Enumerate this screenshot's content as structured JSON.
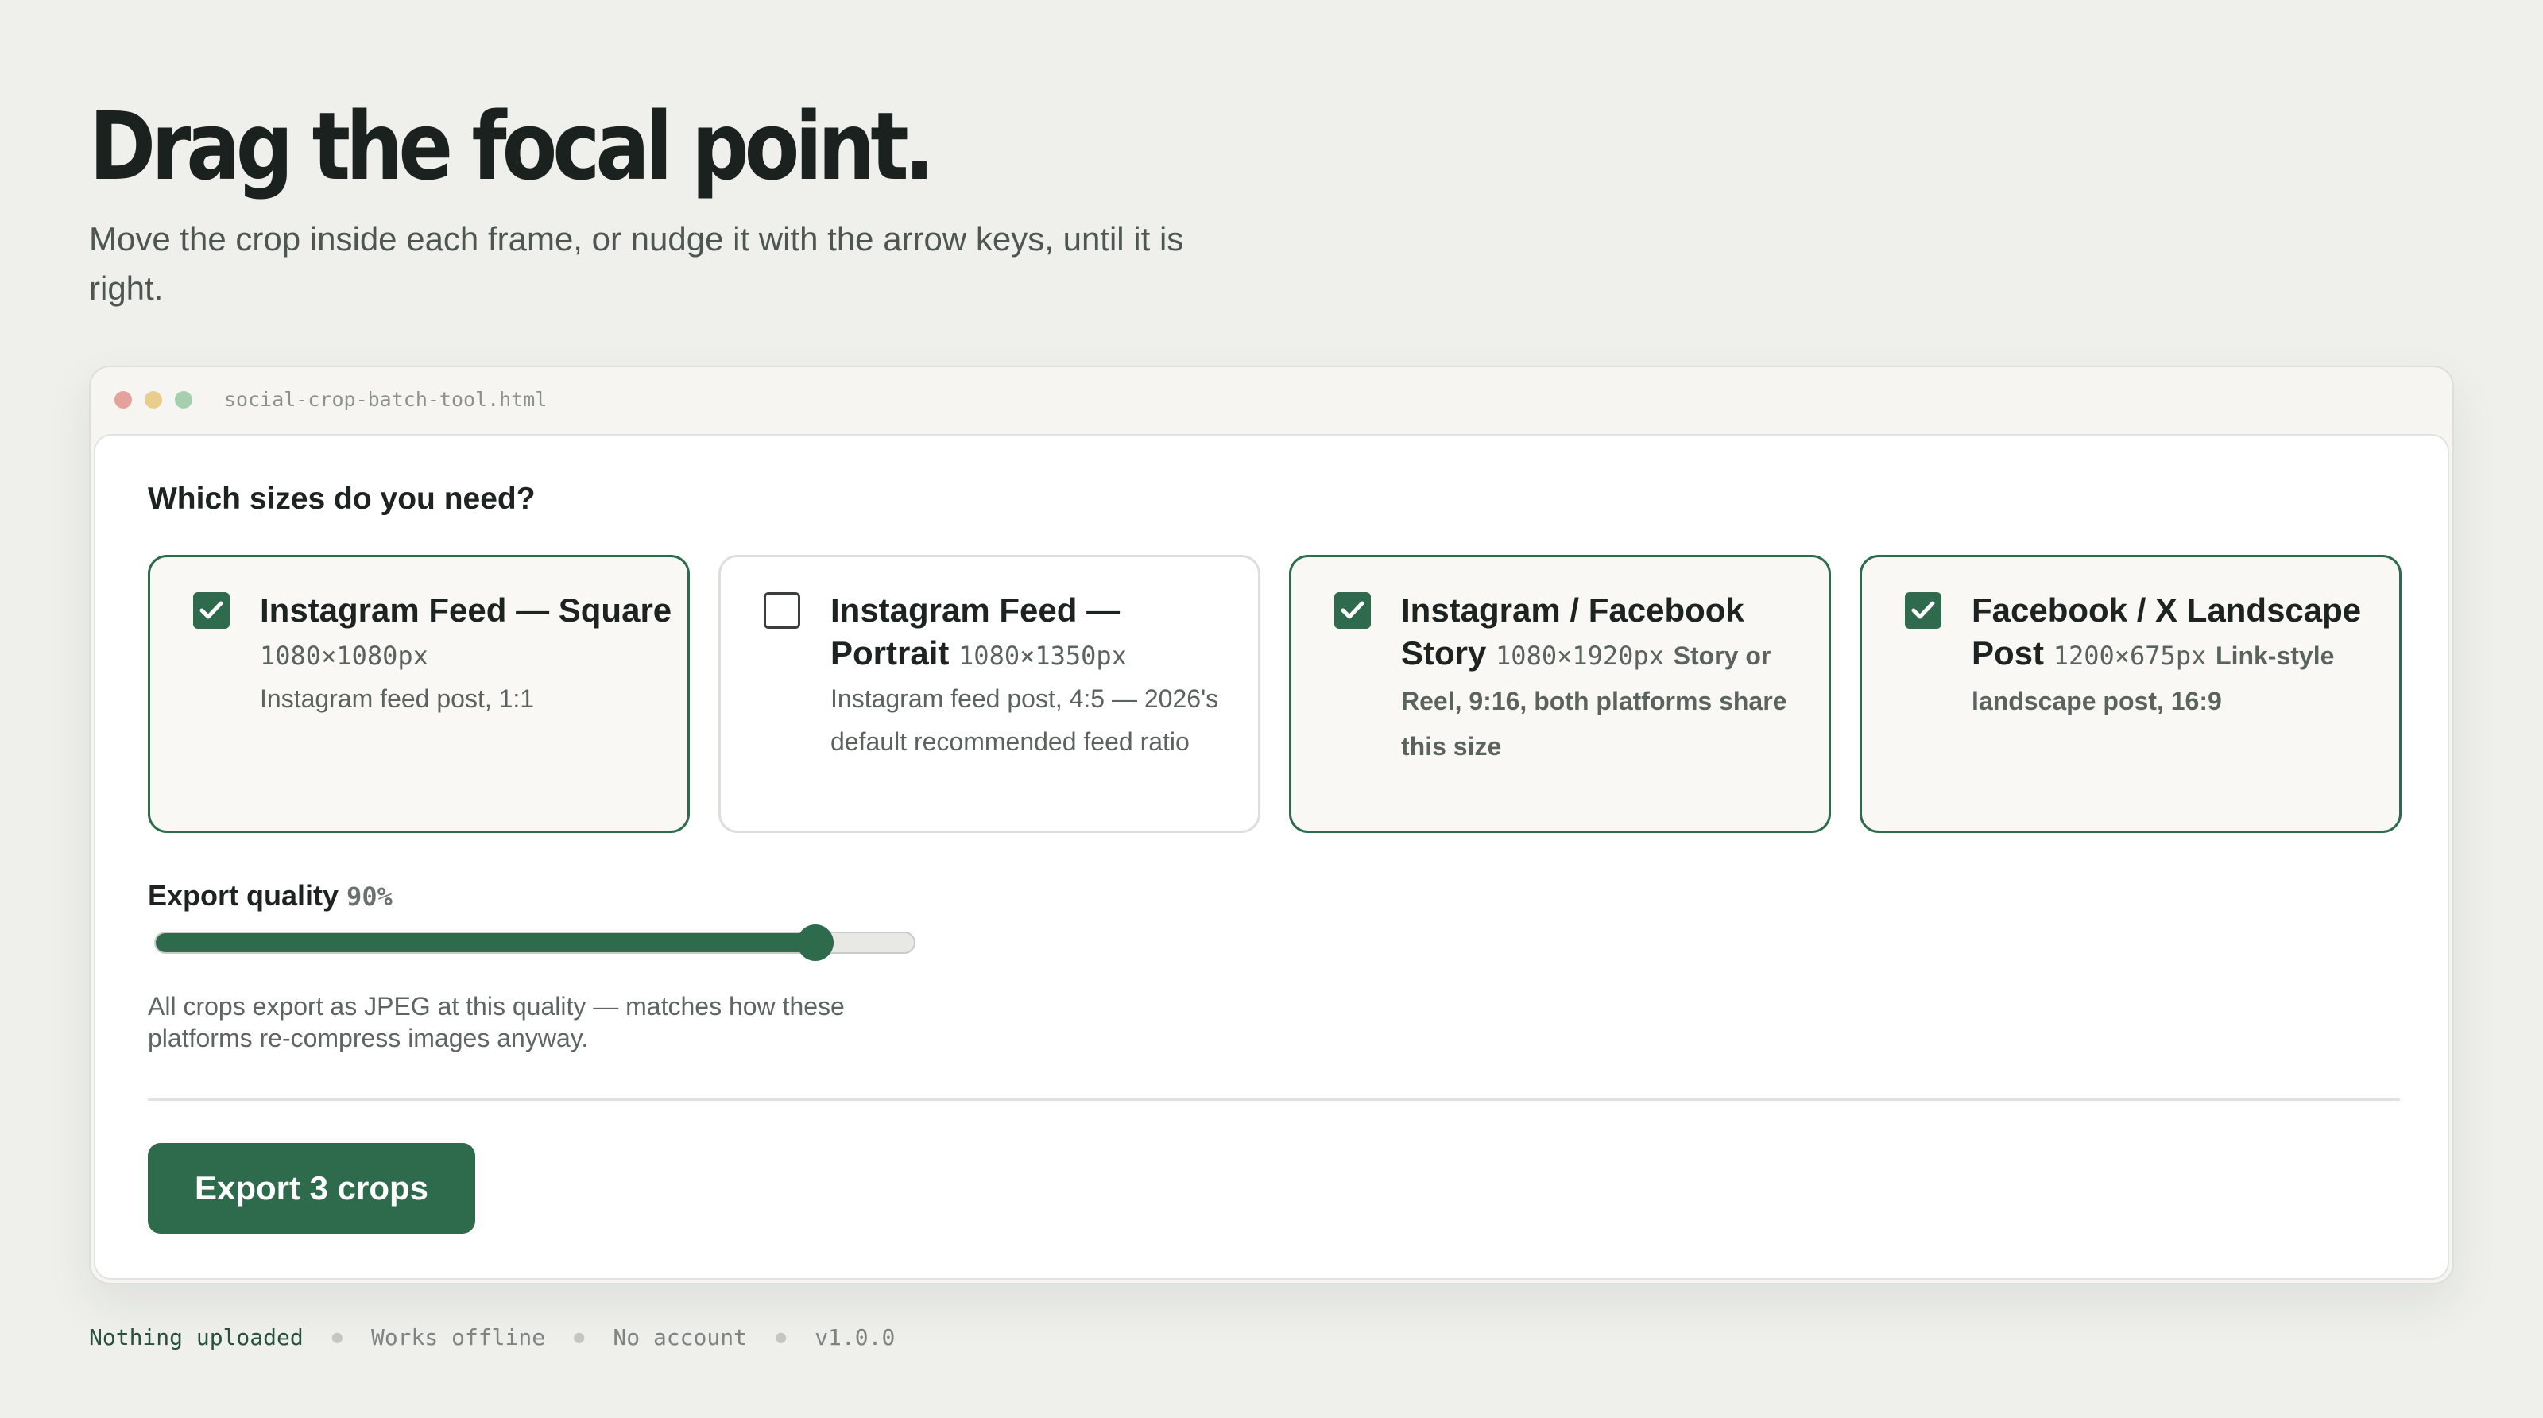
{
  "page": {
    "title": "Drag the focal point.",
    "subtitle": "Move the crop inside each frame, or nudge it with the arrow keys, until it is right."
  },
  "window": {
    "filename": "social-crop-batch-tool.html"
  },
  "sizes": {
    "question": "Which sizes do you need?",
    "cards": [
      {
        "title": "Instagram Feed — Square",
        "size": "1080×1080px",
        "desc": "Instagram feed post, 1:1",
        "checked": true
      },
      {
        "title": "Instagram Feed — Portrait",
        "size": "1080×1350px",
        "desc": "Instagram feed post, 4:5 — 2026's default recommended feed ratio",
        "checked": false
      },
      {
        "title": "Instagram / Facebook Story",
        "size": "1080×1920px",
        "desc": "Story or Reel, 9:16, both platforms share this size",
        "checked": true
      },
      {
        "title": "Facebook / X Landscape Post",
        "size": "1200×675px",
        "desc": "Link-style landscape post, 16:9",
        "checked": true
      }
    ]
  },
  "quality": {
    "label": "Export quality",
    "value_text": "90%",
    "value": 90,
    "help": "All crops export as JPEG at this quality — matches how these platforms re-compress images anyway."
  },
  "actions": {
    "export_label": "Export 3 crops"
  },
  "footer": {
    "items": [
      "Nothing uploaded",
      "Works offline",
      "No account",
      "v1.0.0"
    ]
  },
  "colors": {
    "accent": "#2e6b4c",
    "background": "#eff0ec",
    "panel": "#ffffff",
    "text": "#1d2320",
    "muted": "#5b635f"
  }
}
